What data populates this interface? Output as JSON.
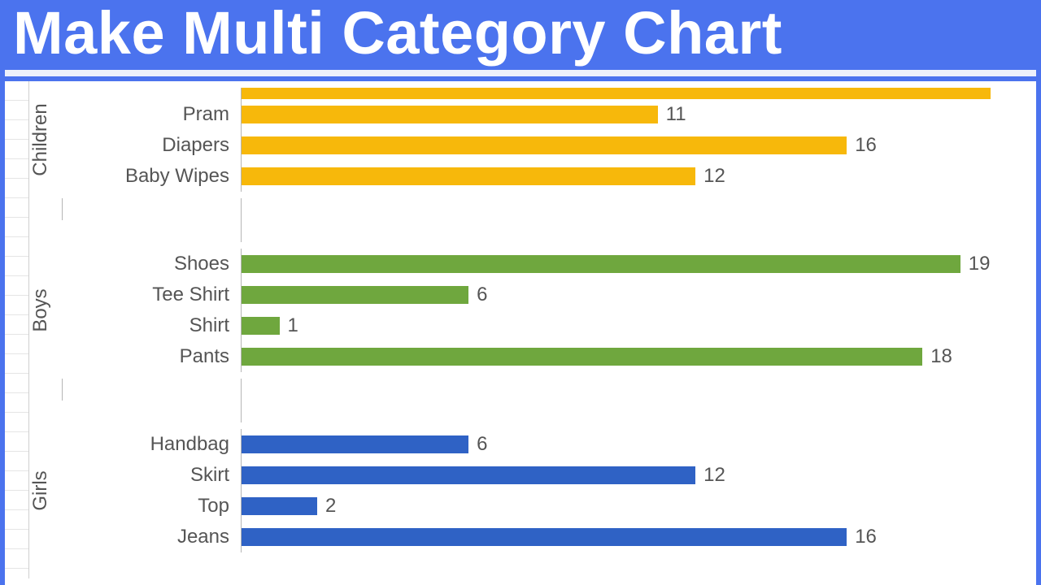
{
  "header": {
    "title": "Make Multi Category Chart"
  },
  "chart_data": {
    "type": "bar",
    "orientation": "horizontal",
    "title": "",
    "xlabel": "",
    "ylabel": "",
    "xlim": [
      0,
      20
    ],
    "groups": [
      {
        "name": "Children",
        "color": "#f7b80b",
        "items": [
          {
            "label": "Pram",
            "value": 11
          },
          {
            "label": "Diapers",
            "value": 16
          },
          {
            "label": "Baby Wipes",
            "value": 12
          }
        ]
      },
      {
        "name": "Boys",
        "color": "#6fa73e",
        "items": [
          {
            "label": "Shoes",
            "value": 19
          },
          {
            "label": "Tee Shirt",
            "value": 6
          },
          {
            "label": "Shirt",
            "value": 1
          },
          {
            "label": "Pants",
            "value": 18
          }
        ]
      },
      {
        "name": "Girls",
        "color": "#2f62c5",
        "items": [
          {
            "label": "Handbag",
            "value": 6
          },
          {
            "label": "Skirt",
            "value": 12
          },
          {
            "label": "Top",
            "value": 2
          },
          {
            "label": "Jeans",
            "value": 16
          }
        ]
      }
    ]
  }
}
